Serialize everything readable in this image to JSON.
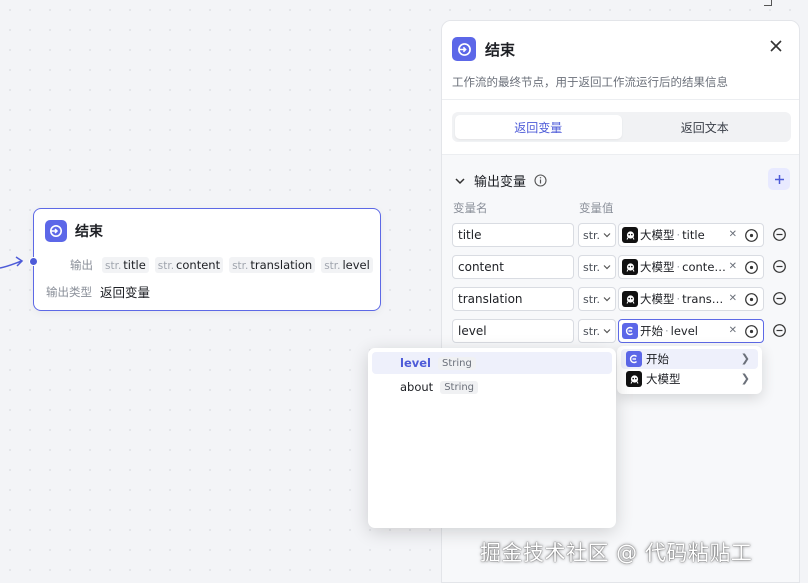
{
  "canvas": {
    "node": {
      "title": "结束",
      "output_label": "输出",
      "outputs": [
        {
          "type": "str.",
          "name": "title"
        },
        {
          "type": "str.",
          "name": "content"
        },
        {
          "type": "str.",
          "name": "translation"
        },
        {
          "type": "str.",
          "name": "level"
        }
      ],
      "output_type_label": "输出类型",
      "output_type_value": "返回变量"
    }
  },
  "panel": {
    "title": "结束",
    "description": "工作流的最终节点，用于返回工作流运行后的结果信息",
    "tabs": [
      {
        "label": "返回变量",
        "active": true
      },
      {
        "label": "返回文本",
        "active": false
      }
    ],
    "section_title": "输出变量",
    "col_name": "变量名",
    "col_value": "变量值",
    "rows": [
      {
        "name": "title",
        "type": "str.",
        "source": "大模型",
        "field": "title",
        "icon": "llm-icon"
      },
      {
        "name": "content",
        "type": "str.",
        "source": "大模型",
        "field": "conte…",
        "icon": "llm-icon"
      },
      {
        "name": "translation",
        "type": "str.",
        "source": "大模型",
        "field": "trans…",
        "icon": "llm-icon"
      },
      {
        "name": "level",
        "type": "str.",
        "source": "开始",
        "field": "level",
        "icon": "start-icon"
      }
    ]
  },
  "node_menu": [
    {
      "label": "开始",
      "icon": "start-icon"
    },
    {
      "label": "大模型",
      "icon": "llm-icon"
    }
  ],
  "var_menu": [
    {
      "name": "level",
      "type": "String"
    },
    {
      "name": "about",
      "type": "String"
    }
  ],
  "watermark": "掘金技术社区 @ 代码粘贴工",
  "colors": {
    "accent": "#5c67e8",
    "accent_text": "#4d5bd8",
    "llm": "#111111"
  }
}
